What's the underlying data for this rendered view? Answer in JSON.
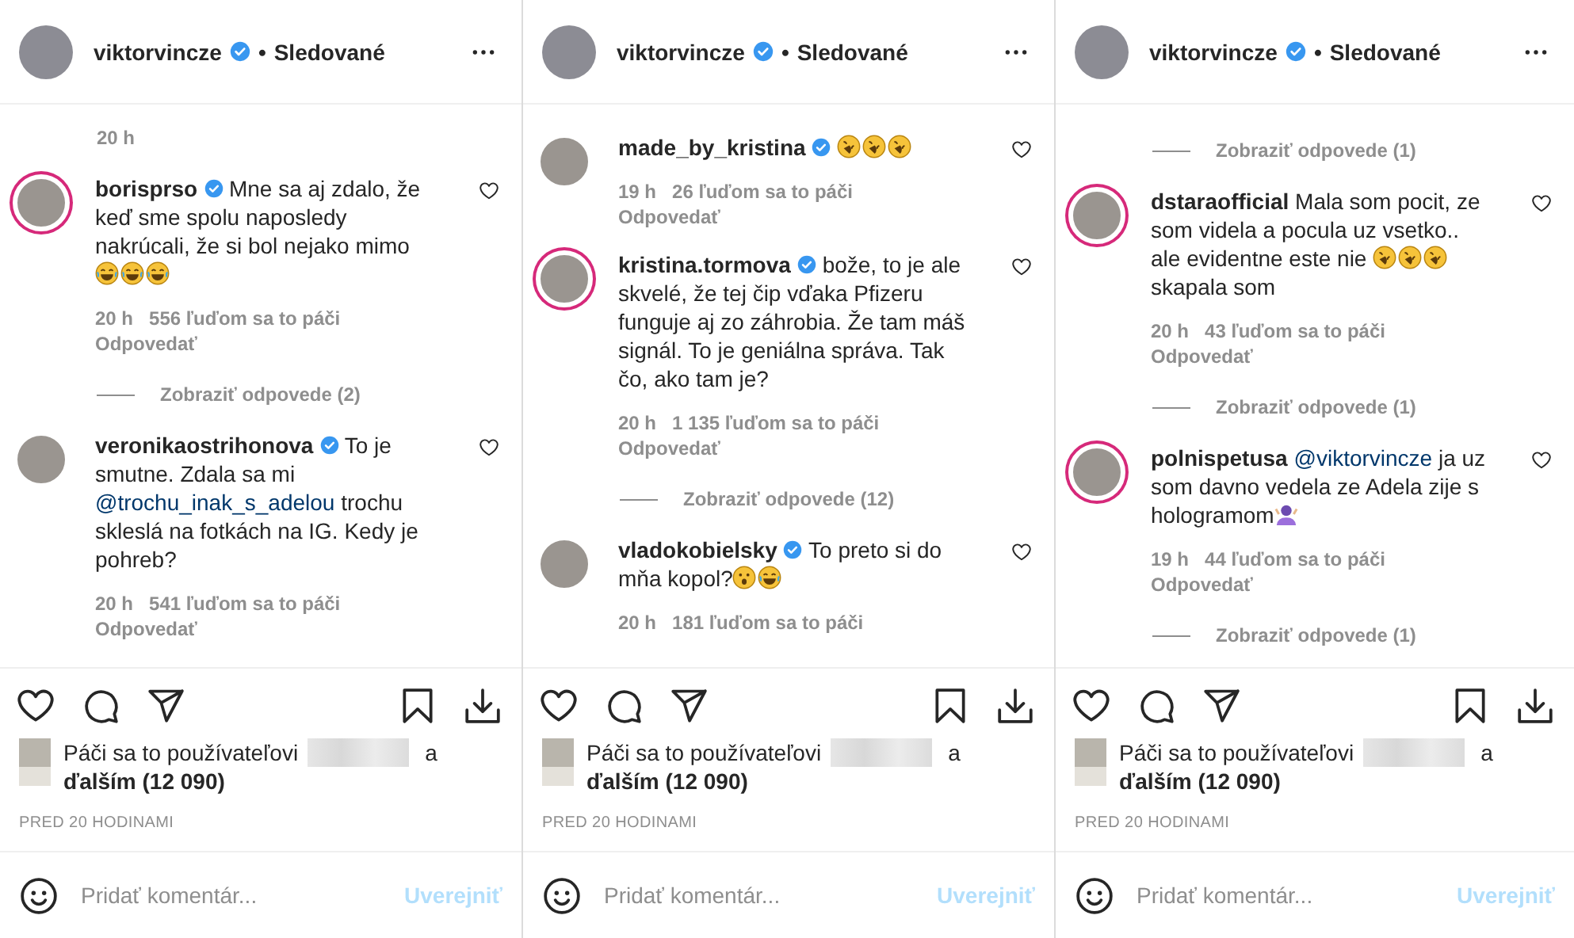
{
  "panels": [
    {
      "header": {
        "username": "viktorvincze",
        "verified": true,
        "separator": "•",
        "status": "Sledované"
      },
      "comments": [
        {
          "kind": "meta",
          "time": "20 h"
        },
        {
          "kind": "comment",
          "username": "borisprso",
          "verified": true,
          "story_ring": true,
          "parts": [
            {
              "kind": "text",
              "text": "Mne sa aj zdalo, že keď sme spolu naposledy nakrúcali, že si bol nejako mimo "
            },
            {
              "kind": "joy"
            },
            {
              "kind": "joy"
            },
            {
              "kind": "joy"
            }
          ],
          "time": "20 h",
          "likes": "556 ľuďom sa to páči",
          "reply": "Odpovedať"
        },
        {
          "kind": "replies",
          "label": "Zobraziť odpovede (2)"
        },
        {
          "kind": "comment",
          "username": "veronikaostrihonova",
          "verified": true,
          "story_ring": false,
          "parts": [
            {
              "kind": "text",
              "text": "To je smutne. Zdala sa mi "
            },
            {
              "kind": "mention",
              "text": "@trochu_inak_s_adelou"
            },
            {
              "kind": "text",
              "text": " trochu skleslá na fotkách na IG. Kedy je pohreb?"
            }
          ],
          "time": "20 h",
          "likes": "541 ľuďom sa to páči",
          "reply": "Odpovedať"
        }
      ],
      "likes": {
        "prefix": "Páči sa to používateľovi",
        "joiner": "a",
        "others": "ďalším (12 090)"
      },
      "timestamp": "PRED 20 HODINAMI",
      "comment_box": {
        "placeholder": "Pridať komentár...",
        "post": "Uverejniť"
      }
    },
    {
      "header": {
        "username": "viktorvincze",
        "verified": true,
        "separator": "•",
        "status": "Sledované"
      },
      "comments": [
        {
          "kind": "comment",
          "username": "made_by_kristina",
          "verified": true,
          "story_ring": false,
          "parts": [
            {
              "kind": "rofl"
            },
            {
              "kind": "rofl"
            },
            {
              "kind": "rofl"
            }
          ],
          "time": "19 h",
          "likes": "26 ľuďom sa to páči",
          "reply": "Odpovedať"
        },
        {
          "kind": "comment",
          "username": "kristina.tormova",
          "verified": true,
          "story_ring": true,
          "parts": [
            {
              "kind": "text",
              "text": "bože, to je ale skvelé, že tej čip vďaka Pfizeru funguje aj zo záhrobia. Že tam máš signál. To je geniálna správa. Tak čo, ako tam je?"
            }
          ],
          "time": "20 h",
          "likes": "1 135 ľuďom sa to páči",
          "reply": "Odpovedať"
        },
        {
          "kind": "replies",
          "label": "Zobraziť odpovede (12)"
        },
        {
          "kind": "comment",
          "username": "vladokobielsky",
          "verified": true,
          "story_ring": false,
          "parts": [
            {
              "kind": "text",
              "text": "To preto si do mňa kopol?"
            },
            {
              "kind": "surprised"
            },
            {
              "kind": "joy"
            }
          ],
          "time": "20 h",
          "likes": "181 ľuďom sa to páči"
        }
      ],
      "likes": {
        "prefix": "Páči sa to používateľovi",
        "joiner": "a",
        "others": "ďalším (12 090)"
      },
      "timestamp": "PRED 20 HODINAMI",
      "comment_box": {
        "placeholder": "Pridať komentár...",
        "post": "Uverejniť"
      }
    },
    {
      "header": {
        "username": "viktorvincze",
        "verified": true,
        "separator": "•",
        "status": "Sledované"
      },
      "comments": [
        {
          "kind": "replies",
          "label": "Zobraziť odpovede (1)"
        },
        {
          "kind": "comment",
          "username": "dstaraofficial",
          "verified": false,
          "story_ring": true,
          "parts": [
            {
              "kind": "text",
              "text": "Mala som pocit, ze som videla a pocula uz vsetko.. ale evidentne este nie "
            },
            {
              "kind": "rofl"
            },
            {
              "kind": "rofl"
            },
            {
              "kind": "rofl"
            },
            {
              "kind": "text",
              "text": " skapala som"
            }
          ],
          "time": "20 h",
          "likes": "43 ľuďom sa to páči",
          "reply": "Odpovedať"
        },
        {
          "kind": "replies",
          "label": "Zobraziť odpovede (1)"
        },
        {
          "kind": "comment",
          "username": "polnispetusa",
          "verified": false,
          "story_ring": true,
          "parts": [
            {
              "kind": "mention",
              "text": "@viktorvincze"
            },
            {
              "kind": "text",
              "text": " ja uz som davno vedela ze Adela zije s hologramom"
            },
            {
              "kind": "person"
            }
          ],
          "time": "19 h",
          "likes": "44 ľuďom sa to páči",
          "reply": "Odpovedať"
        },
        {
          "kind": "replies",
          "label": "Zobraziť odpovede (1)"
        }
      ],
      "likes": {
        "prefix": "Páči sa to používateľovi",
        "joiner": "a",
        "others": "ďalším (12 090)"
      },
      "timestamp": "PRED 20 HODINAMI",
      "comment_box": {
        "placeholder": "Pridať komentár...",
        "post": "Uverejniť"
      }
    }
  ]
}
